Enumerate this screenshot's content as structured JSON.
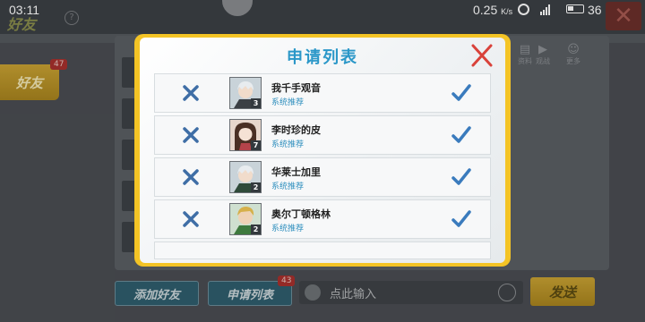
{
  "status_bar": {
    "time": "03:11",
    "network_speed": "0.25",
    "network_unit": "K/s",
    "battery_level": "36"
  },
  "background": {
    "page_title": "好友",
    "friends_button": "好友",
    "friends_badge": "47",
    "side_icons": [
      {
        "icon": "profile-icon",
        "label": "资料"
      },
      {
        "icon": "play-icon",
        "label": "观战"
      },
      {
        "icon": "more-icon",
        "label": "更多"
      }
    ],
    "add_friend_button": "添加好友",
    "request_list_button": "申请列表",
    "request_badge": "43",
    "chat_input_placeholder": "点此输入",
    "send_button": "发送"
  },
  "dialog": {
    "title": "申请列表",
    "requests": [
      {
        "name": "我千手观音",
        "source": "系统推荐",
        "level": "3",
        "avatar": "white-hair-male"
      },
      {
        "name": "李时珍的皮",
        "source": "系统推荐",
        "level": "7",
        "avatar": "brown-hair-female"
      },
      {
        "name": "华莱士加里",
        "source": "系统推荐",
        "level": "2",
        "avatar": "white-hair-male"
      },
      {
        "name": "奥尔丁顿格林",
        "source": "系统推荐",
        "level": "2",
        "avatar": "blonde-hair-male"
      }
    ]
  },
  "colors": {
    "frame_yellow": "#f4c425",
    "title_blue": "#2a97c8",
    "icon_blue": "#3a7bbd",
    "close_red": "#d9423a",
    "reject_blue": "#3f6ea6"
  }
}
